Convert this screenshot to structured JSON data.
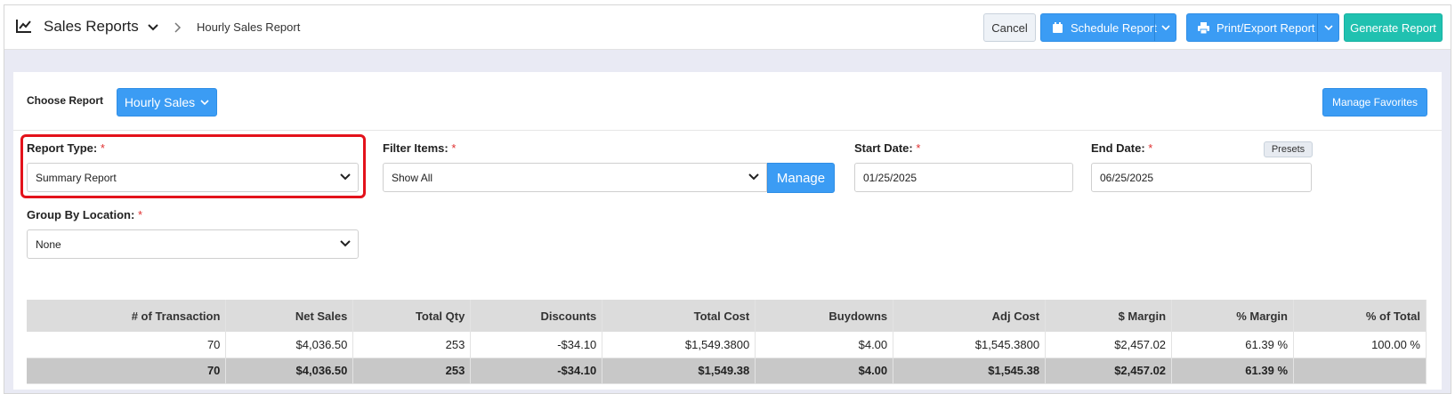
{
  "header": {
    "title": "Sales Reports",
    "breadcrumb": "Hourly Sales Report",
    "buttons": {
      "cancel": "Cancel",
      "schedule": "Schedule Report",
      "print_export": "Print/Export Report",
      "generate": "Generate Report"
    }
  },
  "panel": {
    "choose_report_label": "Choose Report",
    "choose_report_value": "Hourly Sales",
    "manage_favorites": "Manage Favorites",
    "report_type": {
      "label": "Report Type:",
      "value": "Summary Report"
    },
    "filter_items": {
      "label": "Filter Items:",
      "value": "Show All",
      "manage_button": "Manage"
    },
    "start_date": {
      "label": "Start Date:",
      "value": "01/25/2025"
    },
    "end_date": {
      "label": "End Date:",
      "value": "06/25/2025",
      "presets_button": "Presets"
    },
    "group_by_location": {
      "label": "Group By Location:",
      "value": "None"
    },
    "required_marker": "*"
  },
  "table": {
    "columns": [
      "# of Transaction",
      "Net Sales",
      "Total Qty",
      "Discounts",
      "Total Cost",
      "Buydowns",
      "Adj Cost",
      "$ Margin",
      "% Margin",
      "% of Total"
    ],
    "rows": [
      [
        "70",
        "$4,036.50",
        "253",
        "-$34.10",
        "$1,549.3800",
        "$4.00",
        "$1,545.3800",
        "$2,457.02",
        "61.39 %",
        "100.00 %"
      ]
    ],
    "totals": [
      "70",
      "$4,036.50",
      "253",
      "-$34.10",
      "$1,549.38",
      "$4.00",
      "$1,545.38",
      "$2,457.02",
      "61.39 %",
      ""
    ]
  },
  "colors": {
    "primary_blue": "#3b9cf4",
    "teal": "#20c1b0",
    "highlight_red": "#e3121b",
    "required_red": "#e03131"
  }
}
